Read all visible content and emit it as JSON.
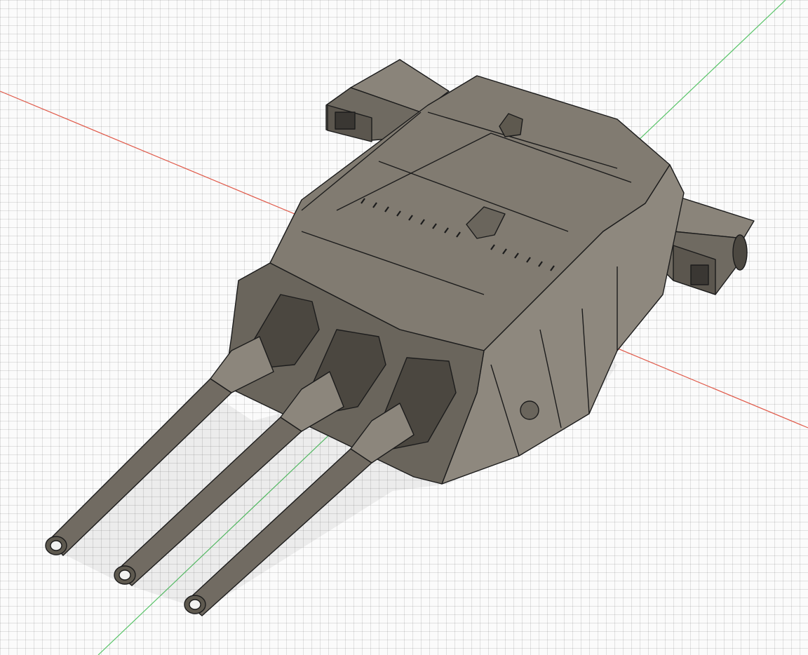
{
  "viewport": {
    "background": "#fbfbfb",
    "grid_color": "#d6d6d6",
    "axis_x_color": "#e05a4a",
    "axis_y_color": "#58c468"
  },
  "model": {
    "body_color": "#7b756b",
    "body_light": "#8c867c",
    "body_dark": "#5e594f",
    "edge_color": "#1c1c1c",
    "barrel_count": 3
  }
}
